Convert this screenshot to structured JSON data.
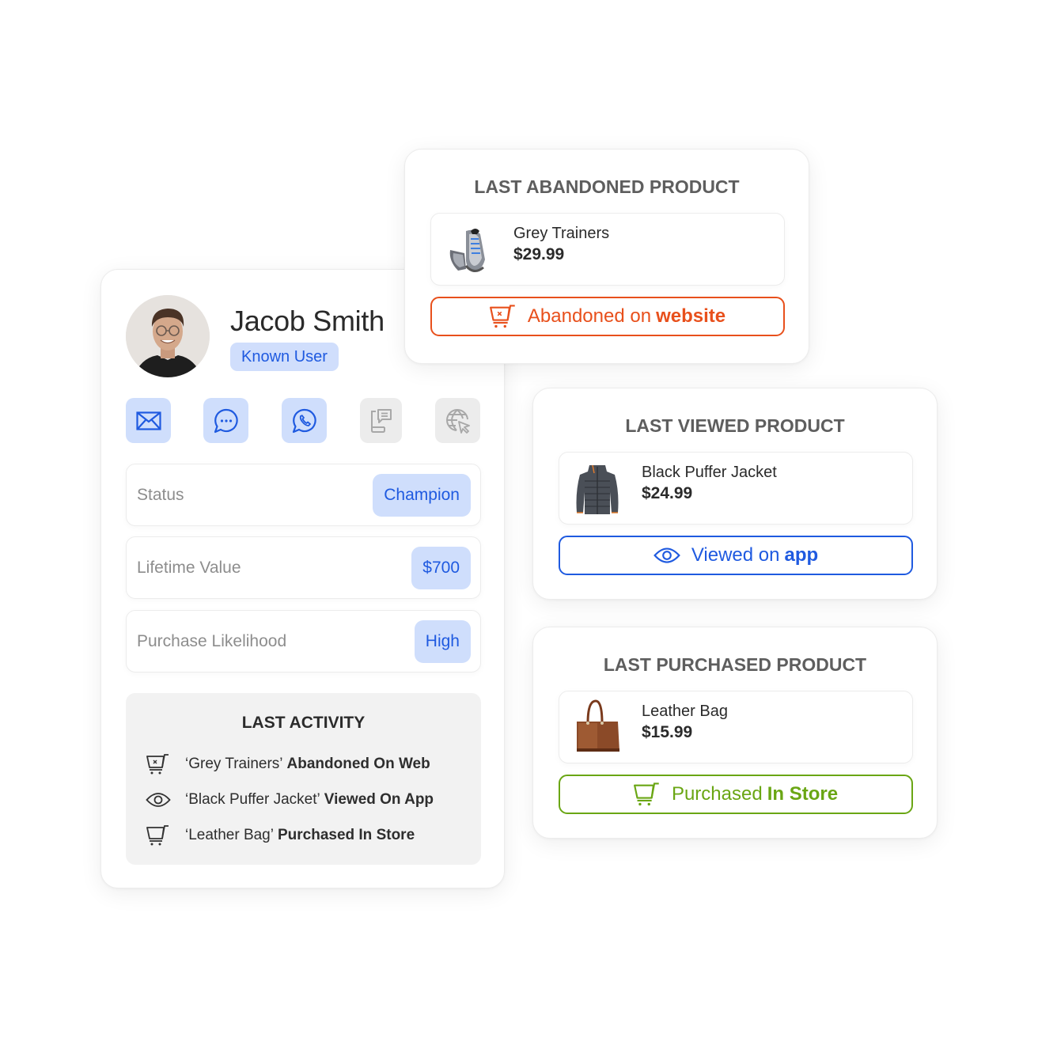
{
  "profile": {
    "name": "Jacob Smith",
    "badge": "Known User",
    "channels": [
      {
        "icon": "email-icon",
        "active": true
      },
      {
        "icon": "chat-bubble-icon",
        "active": true
      },
      {
        "icon": "whatsapp-icon",
        "active": true
      },
      {
        "icon": "mobile-message-icon",
        "active": false
      },
      {
        "icon": "web-cursor-icon",
        "active": false
      }
    ],
    "attributes": [
      {
        "label": "Status",
        "value": "Champion"
      },
      {
        "label": "Lifetime Value",
        "value": "$700"
      },
      {
        "label": "Purchase Likelihood",
        "value": "High"
      }
    ],
    "activity": {
      "title": "LAST ACTIVITY",
      "items": [
        {
          "icon": "cart-abandoned-icon",
          "product": "‘Grey Trainers’",
          "action": "Abandoned On Web"
        },
        {
          "icon": "eye-icon",
          "product": "‘Black Puffer Jacket’",
          "action": "Viewed On App"
        },
        {
          "icon": "cart-icon",
          "product": "‘Leather Bag’",
          "action": "Purchased In Store"
        }
      ]
    }
  },
  "abandoned": {
    "title": "LAST ABANDONED PRODUCT",
    "product_name": "Grey Trainers",
    "price": "$29.99",
    "image": "grey-trainers-image",
    "button_prefix": "Abandoned on",
    "button_channel": "website",
    "color": "#e8501c"
  },
  "viewed": {
    "title": "LAST VIEWED PRODUCT",
    "product_name": "Black Puffer Jacket",
    "price": "$24.99",
    "image": "puffer-jacket-image",
    "button_prefix": "Viewed on",
    "button_channel": "app",
    "color": "#1f5ae0"
  },
  "purchased": {
    "title": "LAST PURCHASED PRODUCT",
    "product_name": "Leather Bag",
    "price": "$15.99",
    "image": "leather-bag-image",
    "button_prefix": "Purchased",
    "button_channel": "In Store",
    "color": "#6aa614"
  }
}
